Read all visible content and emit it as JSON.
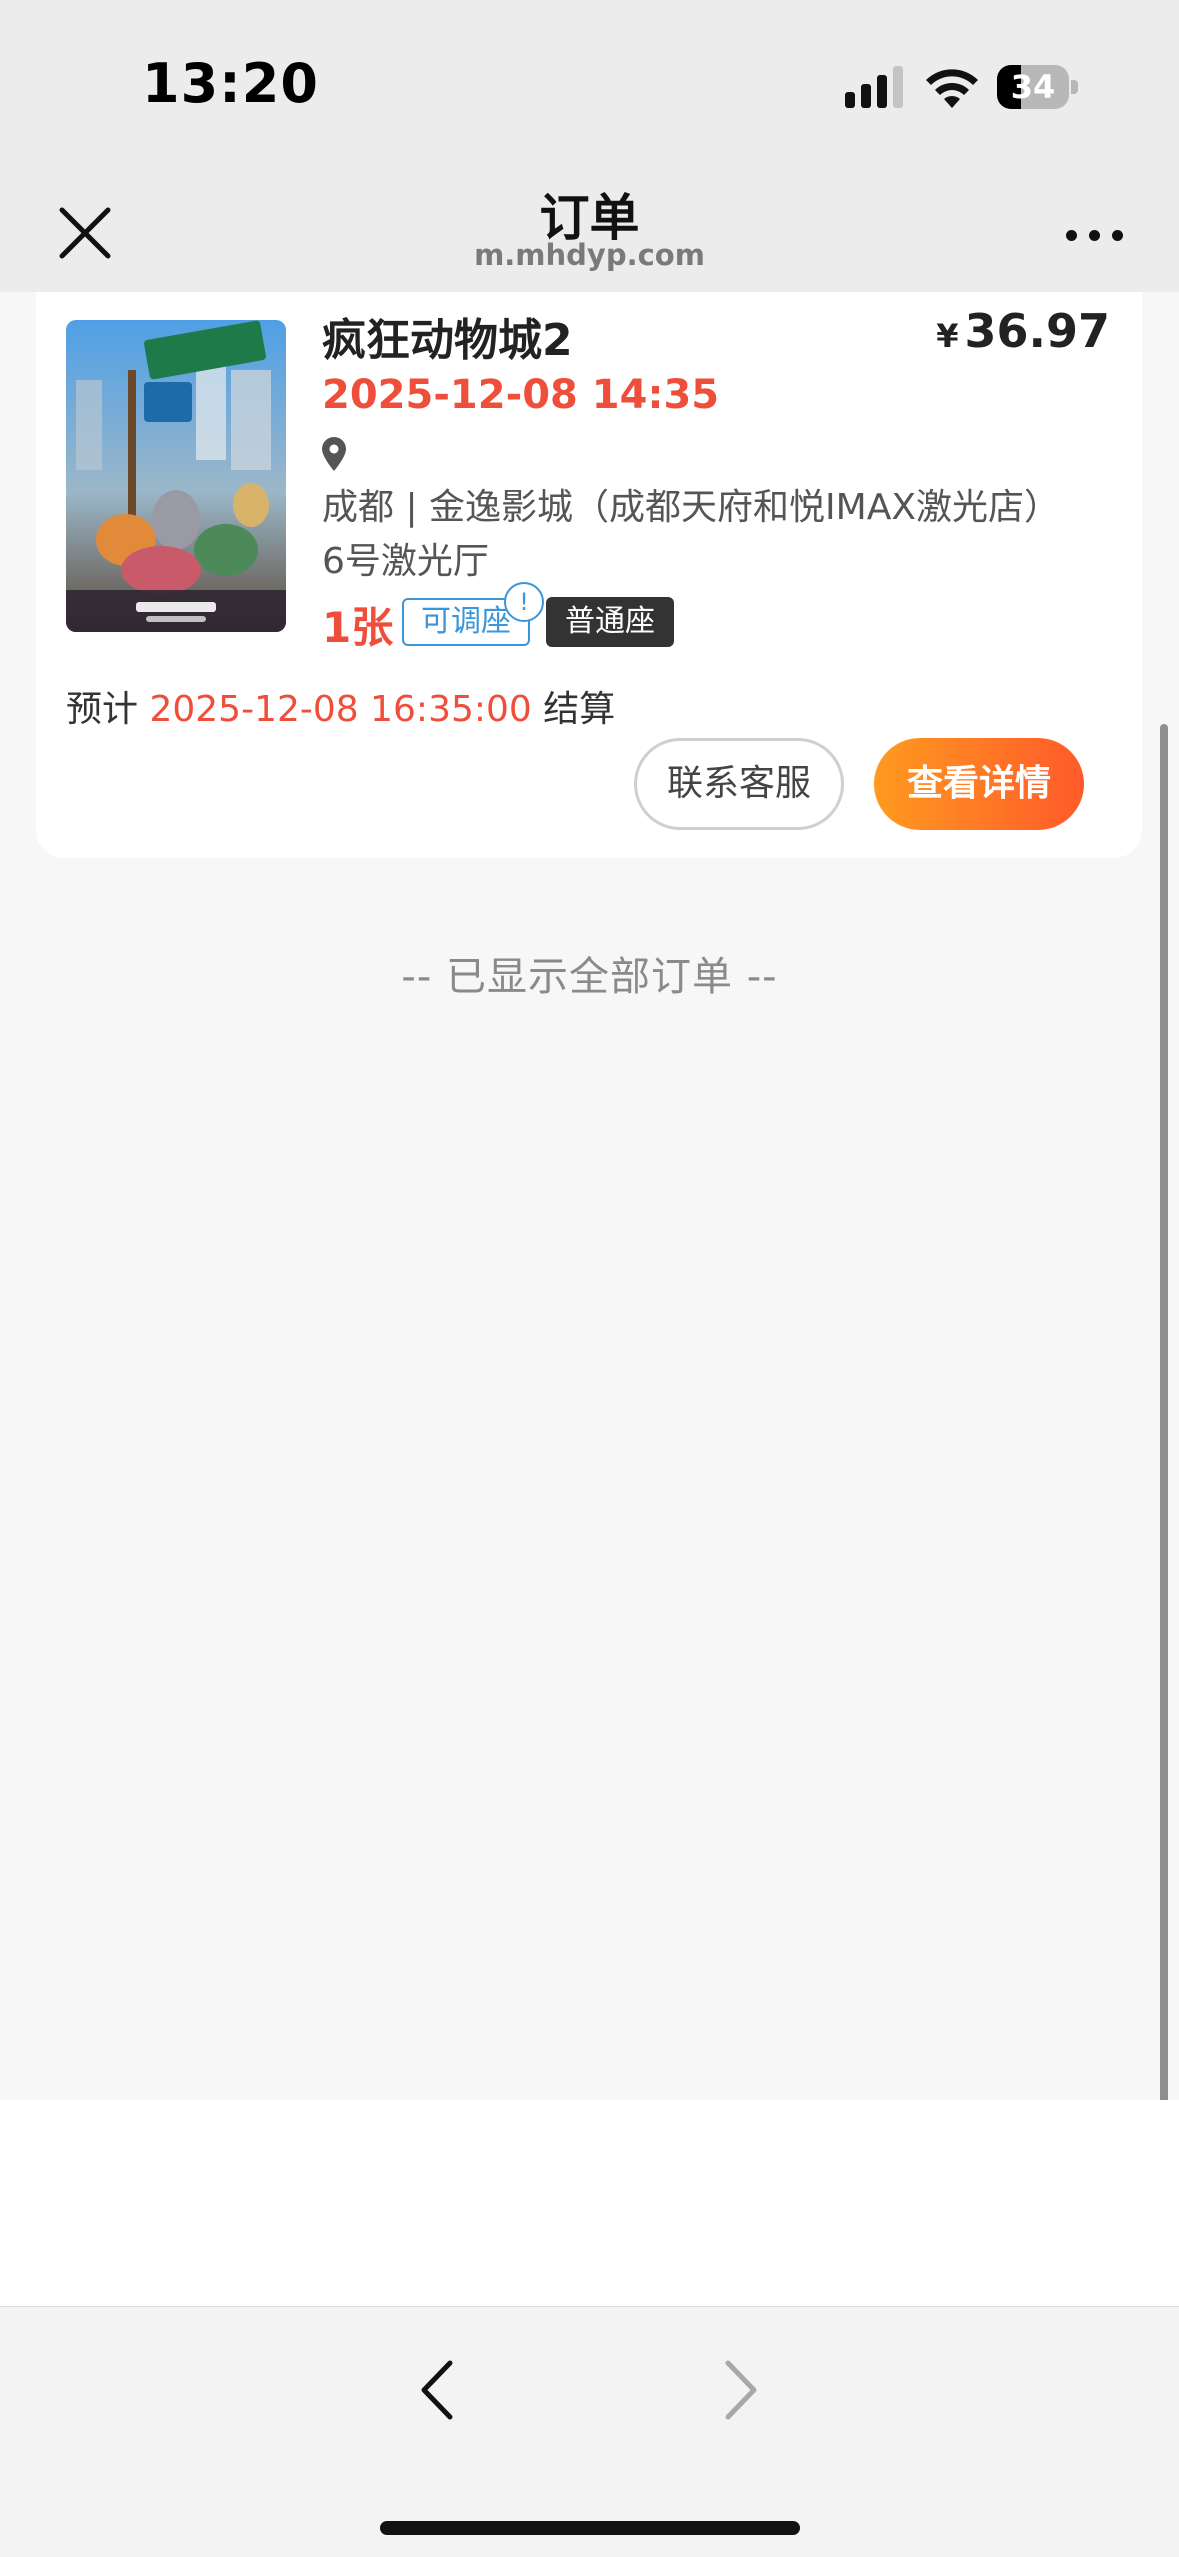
{
  "status_bar": {
    "time": "13:20",
    "battery_level": "34",
    "battery_fraction": 0.34,
    "icons": [
      "cellular-signal-icon",
      "wifi-icon",
      "battery-icon"
    ]
  },
  "nav": {
    "title": "订单",
    "url": "m.mhdyp.com",
    "icons": [
      "close-icon",
      "more-icon"
    ]
  },
  "order": {
    "movie_title": "疯狂动物城2",
    "currency": "¥",
    "price": "36.97",
    "showtime": "2025-12-08 14:35",
    "location": "成都 | 金逸影城（成都天府和悦IMAX激光店）",
    "hall": "6号激光厅",
    "ticket_count": "1张",
    "tag_adjustable": "可调座",
    "info_mark": "!",
    "tag_seat_type": "普通座",
    "settle_prefix": "预计",
    "settle_time": "2025-12-08 16:35:00",
    "settle_suffix": "结算",
    "btn_service": "联系客服",
    "btn_detail": "查看详情"
  },
  "list_end_text": "-- 已显示全部订单 --",
  "colors": {
    "accent_red": "#ef4e3a",
    "accent_blue": "#3a95d9",
    "button_gradient_start": "#ff9a1f",
    "button_gradient_end": "#ff5a2a",
    "page_bg": "#f7f7f7"
  },
  "bottom_toolbar": {
    "icons": [
      "back-chevron-icon",
      "forward-chevron-icon"
    ]
  }
}
